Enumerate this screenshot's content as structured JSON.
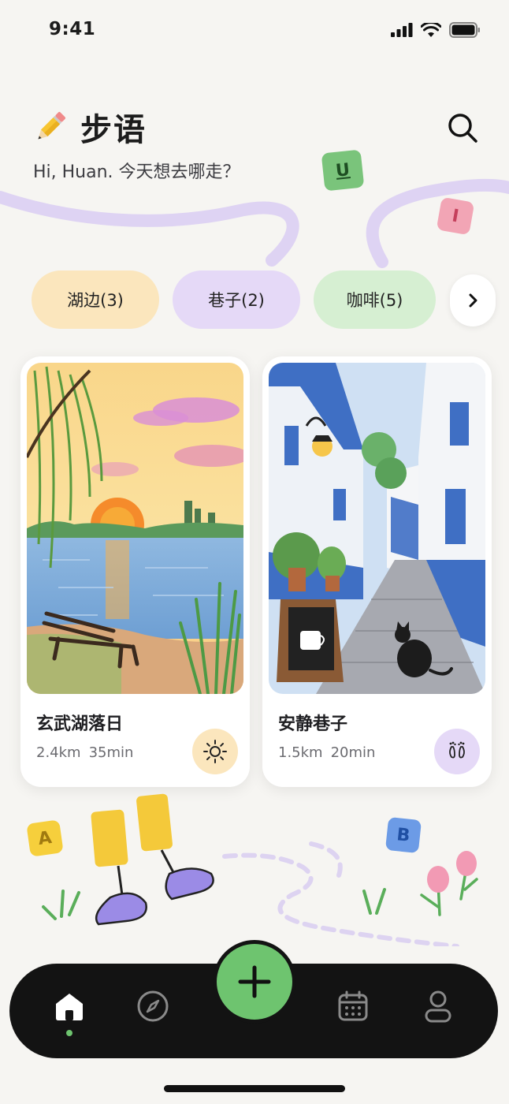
{
  "status_bar": {
    "time": "9:41"
  },
  "header": {
    "app_name": "步语",
    "greeting": "Hi, Huan. 今天想去哪走？"
  },
  "deco_letters": [
    "U",
    "I",
    "A",
    "B"
  ],
  "categories": [
    {
      "label": "湖边(3)",
      "color": "#fbe6bd"
    },
    {
      "label": "巷子(2)",
      "color": "#e5d9f7"
    },
    {
      "label": "咖啡(5)",
      "color": "#d6efd2"
    }
  ],
  "cards": [
    {
      "title": "玄武湖落日",
      "distance": "2.4km",
      "duration": "35min",
      "badge_icon": "sun-icon",
      "badge_color": "#fbe6bd"
    },
    {
      "title": "安静巷子",
      "distance": "1.5km",
      "duration": "20min",
      "badge_icon": "footprints-icon",
      "badge_color": "#e5d9f7"
    }
  ],
  "nav": {
    "items": [
      "home-icon",
      "compass-icon",
      "add-icon",
      "calendar-icon",
      "profile-icon"
    ],
    "active": "home-icon",
    "accent": "#6ec46f"
  }
}
